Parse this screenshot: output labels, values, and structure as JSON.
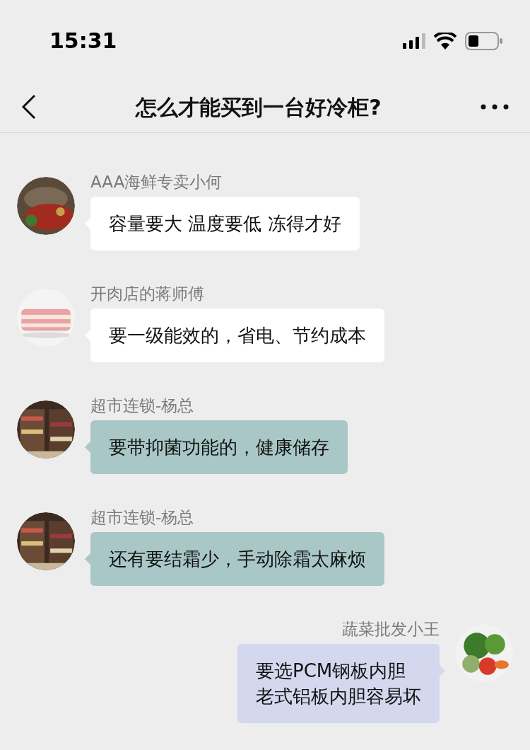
{
  "status_bar": {
    "time": "15:31"
  },
  "header": {
    "title": "怎么才能买到一台好冷柜?"
  },
  "messages": [
    {
      "sender": "AAA海鲜专卖小何",
      "lines": [
        "容量要大 温度要低 冻得才好"
      ],
      "kind": "incoming",
      "color": "#ffffff",
      "avatar": {
        "kind": "picture"
      }
    },
    {
      "sender": "开肉店的蒋师傅",
      "lines": [
        "要一级能效的，省电、节约成本"
      ],
      "kind": "incoming",
      "color": "#ffffff",
      "avatar": {
        "kind": "picture"
      }
    },
    {
      "sender": "超市连锁-杨总",
      "lines": [
        "要带抑菌功能的，健康储存"
      ],
      "kind": "incoming",
      "color": "#a9c7c6",
      "avatar": {
        "kind": "picture"
      }
    },
    {
      "sender": "超市连锁-杨总",
      "lines": [
        "还有要结霜少，手动除霜太麻烦"
      ],
      "kind": "incoming",
      "color": "#a9c7c6",
      "avatar": {
        "kind": "picture"
      }
    },
    {
      "sender": "蔬菜批发小王",
      "lines": [
        "要选PCM钢板内胆",
        "老式铝板内胆容易坏"
      ],
      "kind": "outgoing",
      "color": "#d3d8ef",
      "avatar": {
        "kind": "picture"
      }
    }
  ]
}
